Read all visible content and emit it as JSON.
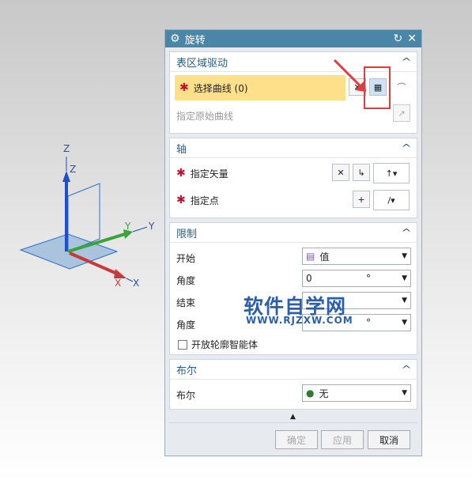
{
  "dialog": {
    "title": "旋转"
  },
  "sections": {
    "region": {
      "header": "表区域驱动",
      "select_curve": "选择曲线 (0)",
      "origin_curve": "指定原始曲线"
    },
    "axis": {
      "header": "轴",
      "vector": "指定矢量",
      "point": "指定点"
    },
    "limits": {
      "header": "限制",
      "start_label": "开始",
      "start_value": "值",
      "angle1_label": "角度",
      "angle1_value": "0",
      "angle1_unit": "°",
      "end_label": "结束",
      "angle2_label": "角度",
      "angle2_unit": "°",
      "open_profile": "开放轮廓智能体"
    },
    "boolean": {
      "header": "布尔",
      "label": "布尔",
      "value": "无"
    }
  },
  "footer": {
    "ok": "确定",
    "apply": "应用",
    "cancel": "取消"
  },
  "scene": {
    "axes": {
      "z_outer": "Z",
      "z_inner": "Z",
      "y_outer": "Y",
      "y_inner": "Y",
      "x_outer": "X",
      "x_inner": "X"
    }
  },
  "watermark": {
    "main": "软件自学网",
    "url": "WWW.RJZXW.COM"
  },
  "colors": {
    "accent": "#4a86a8",
    "highlight": "#ffe08a",
    "annotation": "#e23b3b"
  }
}
